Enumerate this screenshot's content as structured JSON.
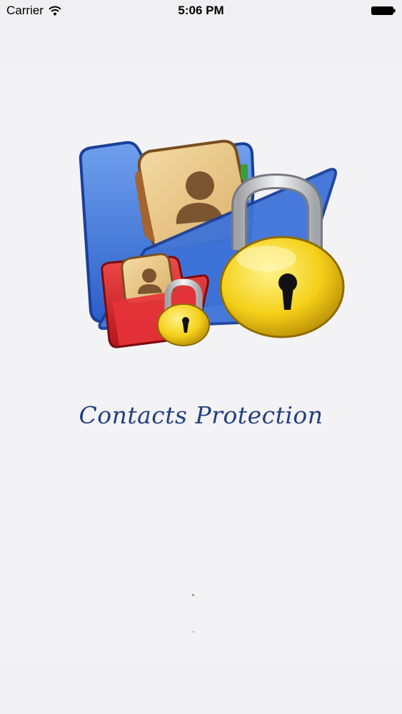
{
  "status_bar": {
    "carrier": "Carrier",
    "time": "5:06 PM"
  },
  "splash": {
    "app_name": "Contacts Protection",
    "logo_icon": "contacts-folder-padlock-icon"
  },
  "colors": {
    "title": "#23407f",
    "folder_blue": "#3b73d8",
    "folder_red": "#d9262c",
    "padlock_gold": "#f5d21a"
  }
}
